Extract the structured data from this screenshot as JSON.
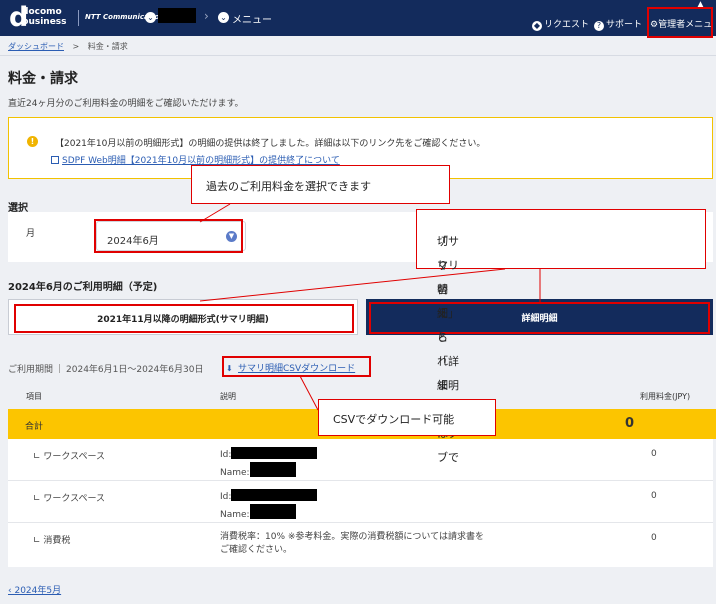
{
  "header": {
    "logo_d": "d",
    "logo_line1": "docomo",
    "logo_line2": "business",
    "partner": "NTT Communications",
    "menu_label": "メニュー",
    "request_label": "リクエスト",
    "support_label": "サポート",
    "admin_label": "管理者メニュー"
  },
  "breadcrumb": {
    "dashboard": "ダッシュボード",
    "separator": ">",
    "current": "料金・請求"
  },
  "page": {
    "title": "料金・請求",
    "description": "直近24ヶ月分のご利用料金の明細をご確認いただけます。"
  },
  "notice": {
    "text": "【2021年10月以前の明細形式】の明細の提供は終了しました。詳細は以下のリンク先をご確認ください。",
    "link": "SDPF Web明細【2021年10月以前の明細形式】の提供終了について"
  },
  "select": {
    "section_title": "選択",
    "month_label": "月",
    "month_value": "2024年6月"
  },
  "usage": {
    "title": "2024年6月のご利用明細（予定)",
    "tab_summary": "2021年11月以降の明細形式(サマリ明細)",
    "tab_detail": "詳細明細",
    "period_label": "ご利用期間",
    "period_value": "2024年6月1日〜2024年6月30日",
    "csv_link": "サマリ明細CSVダウンロード"
  },
  "table": {
    "headers": {
      "item": "項目",
      "desc": "説明",
      "amount": "利用料金(JPY)"
    },
    "total": {
      "label": "合計",
      "amount": "0"
    },
    "rows": [
      {
        "name": "ワークスペース",
        "id_label": "Id:",
        "name_label": "Name:",
        "value": "0"
      },
      {
        "name": "ワークスペース",
        "id_label": "Id:",
        "name_label": "Name:",
        "value": "0"
      },
      {
        "name": "消費税",
        "desc_line1": "消費税率：10% ※参考料金。実際の消費税額については請求書を",
        "desc_line2": "ご確認ください。",
        "value": "0"
      }
    ]
  },
  "pager": {
    "prev": "2024年5月"
  },
  "callouts": {
    "c1": "過去のご利用料金を選択できます",
    "c2_line1": "「サマリ明細」と「詳細明細」はタブで",
    "c2_line2": "切り替えられます。",
    "c3": "CSVでダウンロード可能"
  },
  "colors": {
    "header_bg": "#132b5c",
    "total_row": "#fcc500",
    "highlight": "#e00000",
    "link": "#2b5db3"
  }
}
